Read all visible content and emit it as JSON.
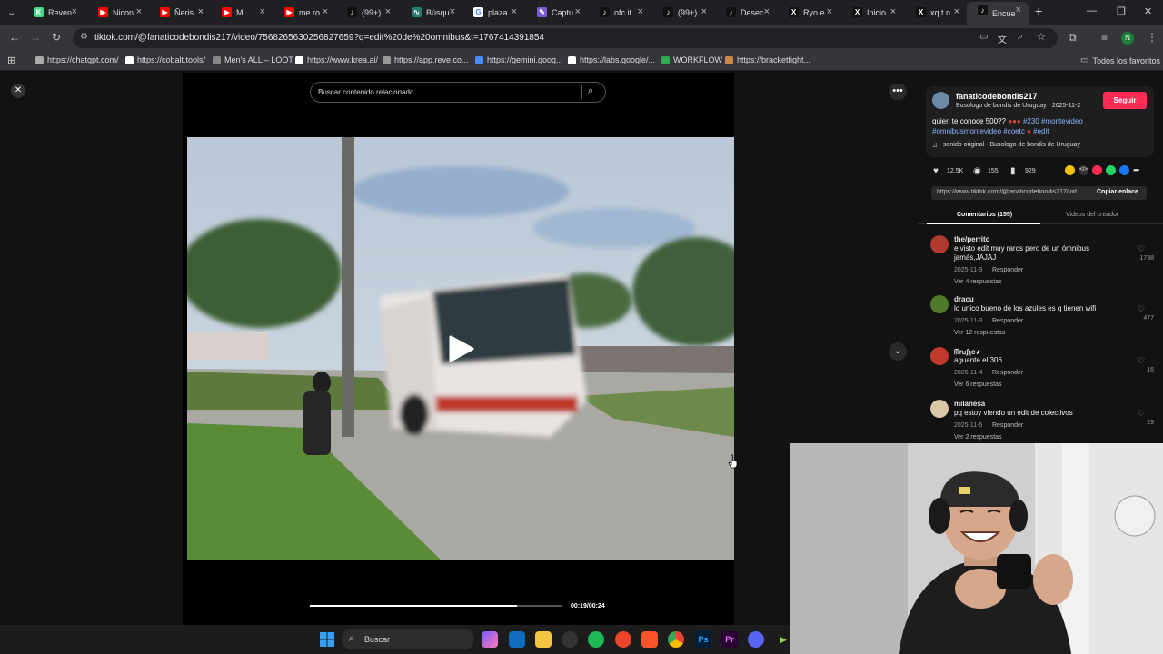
{
  "browser": {
    "tabs": [
      {
        "label": "Reven",
        "fav": "K",
        "color": "#3ddc84"
      },
      {
        "label": "Nicon",
        "fav": "▶",
        "color": "#ff0000"
      },
      {
        "label": "Ñeris",
        "fav": "▶",
        "color": "#ff0000"
      },
      {
        "label": "M",
        "fav": "▶",
        "color": "#ff0000"
      },
      {
        "label": "me ro",
        "fav": "▶",
        "color": "#ff0000"
      },
      {
        "label": "(99+)",
        "fav": "♪",
        "color": "#111111"
      },
      {
        "label": "Búsqu",
        "fav": "∿",
        "color": "#2b7a6b"
      },
      {
        "label": "plaza",
        "fav": "G",
        "color": "#ffffff"
      },
      {
        "label": "Captu",
        "fav": "✎",
        "color": "#7b5cd6"
      },
      {
        "label": "ofc it",
        "fav": "♪",
        "color": "#111111"
      },
      {
        "label": "(99+)",
        "fav": "♪",
        "color": "#111111"
      },
      {
        "label": "Desec",
        "fav": "♪",
        "color": "#111111"
      },
      {
        "label": "Ryo e",
        "fav": "X",
        "color": "#111111"
      },
      {
        "label": "Inicio",
        "fav": "X",
        "color": "#111111"
      },
      {
        "label": "xq t n",
        "fav": "X",
        "color": "#111111"
      },
      {
        "label": "Encue",
        "fav": "♪",
        "color": "#111111"
      }
    ],
    "url": "tiktok.com/@fanaticodebondis217/video/7568265630256827659?q=edit%20de%20omnibus&t=1767414391854",
    "bookmarks": [
      {
        "label": "https://chatgpt.com/",
        "color": "#aaaaaa"
      },
      {
        "label": "https://cobalt.tools/",
        "color": "#ffffff"
      },
      {
        "label": "Men's ALL – LOOT",
        "color": "#888888"
      },
      {
        "label": "https://www.krea.ai/",
        "color": "#ffffff"
      },
      {
        "label": "https://app.reve.co...",
        "color": "#999999"
      },
      {
        "label": "https://gemini.goog...",
        "color": "#4a8cff"
      },
      {
        "label": "https://labs.google/...",
        "color": "#ffffff"
      },
      {
        "label": "WORKFLOW",
        "color": "#34a853"
      },
      {
        "label": "https://bracketfight...",
        "color": "#cc8844"
      }
    ],
    "all_bookmarks": "Todos los favoritos",
    "profile_initial": "N"
  },
  "video": {
    "search_placeholder": "Buscar contenido relacionado",
    "time": "00:19/00:24",
    "progress": 0.82
  },
  "post": {
    "username": "fanaticodebondis217",
    "subtitle": "Busologo de bondis de Uruguay · 2025-11-2",
    "follow_label": "Seguir",
    "caption_text": "quien te conoce 500??",
    "caption_tags": "#230 #montevideo",
    "caption_tags2": "#omnibusmontevideo #coetc",
    "caption_tags3": "#edit",
    "sound": "sonido original - Busologo de bondis de Uruguay",
    "likes": "12.5K",
    "comments": "155",
    "saves": "929",
    "link": "https://www.tiktok.com/@fanaticodebondis217/vid...",
    "copy_label": "Copiar enlace",
    "tab_comments": "Comentarios (155)",
    "tab_creator": "Videos del creador"
  },
  "comments": [
    {
      "name": "the/perrito",
      "text": "e visto edit muy raros pero de un ómnibus jamás,JAJAJ",
      "date": "2025-11-3",
      "reply": "Responder",
      "likes": "1738",
      "replies": "Ver 4 respuestas",
      "avatar": "#b03a2e"
    },
    {
      "name": "dracu",
      "text": "lo unico bueno de los azules es q tienen wifi",
      "date": "2025-11-3",
      "reply": "Responder",
      "likes": "477",
      "replies": "Ver 12 respuestas",
      "avatar": "#4f7a2a"
    },
    {
      "name": "ᗰrᥙʃɿc⸙",
      "text": "aguante el 306",
      "date": "2025-11-4",
      "reply": "Responder",
      "likes": "16",
      "replies": "Ver 6 respuestas",
      "avatar": "#c0392b"
    },
    {
      "name": "milanesa",
      "text": "pq estoy viendo un edit de colectivos",
      "date": "2025-11-5",
      "reply": "Responder",
      "likes": "29",
      "replies": "Ver 2 respuestas",
      "avatar": "#d9c9a8"
    }
  ],
  "taskbar": {
    "search_label": "Buscar"
  }
}
